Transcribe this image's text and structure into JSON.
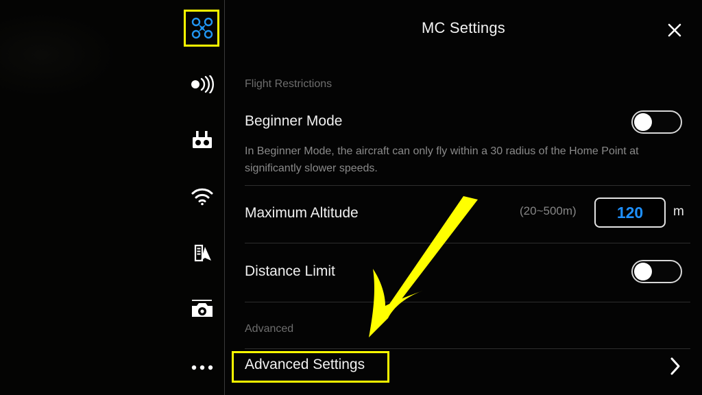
{
  "app": {
    "panel_title": "MC Settings",
    "accent_blue": "#1e90ff",
    "highlight_yellow": "#ffff00",
    "panel_background": "#040404"
  },
  "sidebar": {
    "items": [
      {
        "label": "Aircraft",
        "icon": "drone-icon",
        "selected": true
      },
      {
        "label": "Remote Signal",
        "icon": "signal-transmit-icon",
        "selected": false
      },
      {
        "label": "Remote Controller",
        "icon": "remote-controller-icon",
        "selected": false
      },
      {
        "label": "Image Transmission",
        "icon": "wifi-icon",
        "selected": false
      },
      {
        "label": "Aircraft Battery",
        "icon": "battery-aircraft-icon",
        "selected": false
      },
      {
        "label": "Camera",
        "icon": "camera-icon",
        "selected": false
      },
      {
        "label": "More",
        "icon": "more-dots-icon",
        "selected": false
      }
    ]
  },
  "header": {
    "title": "MC Settings",
    "close_icon": "close-icon"
  },
  "sections": [
    {
      "label": "Flight Restrictions",
      "rows": [
        {
          "title": "Beginner Mode",
          "description": "In Beginner Mode, the aircraft can only fly within a 30 radius of the Home Point at significantly slower speeds.",
          "control": "toggle",
          "toggle_state": "off"
        },
        {
          "title": "Maximum Altitude",
          "range_hint": "(20~500m)",
          "value": "120",
          "unit": "m",
          "control": "number-input"
        },
        {
          "title": "Distance Limit",
          "control": "toggle",
          "toggle_state": "off"
        }
      ]
    },
    {
      "label": "Advanced",
      "rows": [
        {
          "title": "Advanced Settings",
          "control": "navigate",
          "chevron_icon": "chevron-right-icon",
          "highlighted": true
        }
      ]
    }
  ],
  "annotation": {
    "type": "arrow",
    "color": "#ffff00",
    "points_to": "Advanced Settings"
  }
}
